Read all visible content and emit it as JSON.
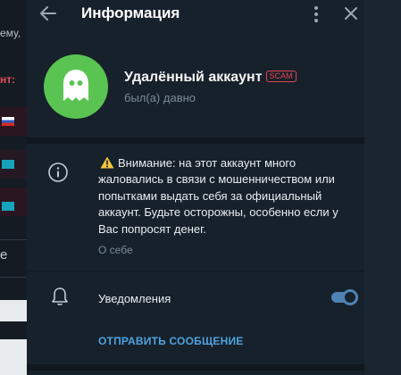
{
  "background": {
    "chat_snippet": "ему,",
    "name_snippet": "нт: ",
    "input_snippet": "е"
  },
  "header": {
    "title": "Информация",
    "back_icon": "arrow-left-icon",
    "more_icon": "vertical-dots-icon",
    "close_icon": "close-icon"
  },
  "profile": {
    "name": "Удалённый аккаунт",
    "badge": "SCAM",
    "status": "был(а) давно",
    "avatar_icon": "ghost-icon",
    "avatar_color": "#5ac453"
  },
  "bio": {
    "warning_icon": "warning-icon",
    "text": "Внимание: на этот аккаунт много жаловались в связи с мошенничеством или попытками выдать себя за официальный аккаунт. Будьте осторожны, особенно если у Вас попросят денег.",
    "caption": "О себе"
  },
  "notifications": {
    "label": "Уведомления",
    "enabled": true,
    "icon": "bell-icon"
  },
  "actions": {
    "send_message": "ОТПРАВИТЬ СООБЩЕНИЕ"
  },
  "colors": {
    "accent": "#4fa3e0",
    "scam": "#e5454e",
    "panel": "#17212b",
    "toggle": "#4e83b5"
  }
}
